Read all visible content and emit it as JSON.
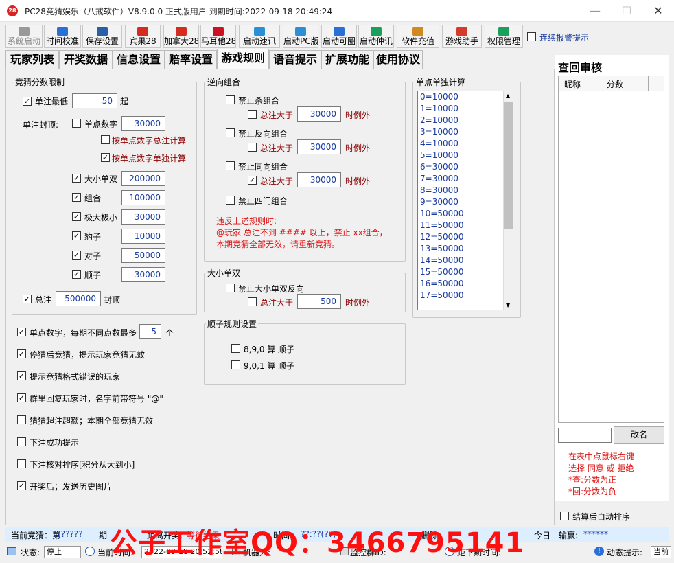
{
  "window": {
    "title": "PC28竞猜娱乐（八戒软件）V8.9.0.0  正式版用户  到期时间:2022-09-18 20:49:24",
    "icon_text": "28"
  },
  "toolbar": {
    "items": [
      {
        "label": "系统启动",
        "icon": "system-start-icon",
        "color": "#999999"
      },
      {
        "label": "时间校准",
        "icon": "clock-icon",
        "color": "#2a6fd6"
      },
      {
        "label": "保存设置",
        "icon": "save-icon",
        "color": "#2a5fa8"
      },
      {
        "label": "宾果28",
        "icon": "china-flag-icon",
        "color": "#d62b1f"
      },
      {
        "label": "加拿大28",
        "icon": "canada-flag-icon",
        "color": "#d62b1f"
      },
      {
        "label": "马耳他28",
        "icon": "malta-flag-icon",
        "color": "#cc1122"
      },
      {
        "label": "启动速讯",
        "icon": "chat-icon",
        "color": "#2a8fd6"
      },
      {
        "label": "启动PC版",
        "icon": "chat-icon",
        "color": "#2a8fd6"
      },
      {
        "label": "启动可圈",
        "icon": "circle-icon",
        "color": "#2a6fd6"
      },
      {
        "label": "启动仲讯",
        "icon": "chat-green-icon",
        "color": "#1aa05a"
      },
      {
        "label": "软件充值",
        "icon": "recharge-icon",
        "color": "#d08a20"
      },
      {
        "label": "游戏助手",
        "icon": "game-assistant-icon",
        "color": "#d63a2a"
      },
      {
        "label": "权限管理",
        "icon": "shield-icon",
        "color": "#1aa05a"
      }
    ],
    "alarm_label": "连续报警提示"
  },
  "tabs": [
    "玩家列表",
    "开奖数据",
    "信息设置",
    "赔率设置",
    "游戏规则",
    "语音提示",
    "扩展功能",
    "使用协议"
  ],
  "active_tab": "游戏规则",
  "bet_limit": {
    "legend": "竞猜分数限制",
    "min_label": "单注最低",
    "min_value": "50",
    "min_suffix": "起",
    "cap_label": "单注封顶:",
    "single_digit_label": "单点数字",
    "single_digit_value": "30000",
    "by_total_label": "按单点数字总注计算",
    "by_single_label": "按单点数字单独计算",
    "rows": [
      {
        "label": "大小单双",
        "value": "200000"
      },
      {
        "label": "组合",
        "value": "100000"
      },
      {
        "label": "极大极小",
        "value": "30000"
      },
      {
        "label": "豹子",
        "value": "10000"
      },
      {
        "label": "对子",
        "value": "50000"
      },
      {
        "label": "顺子",
        "value": "30000"
      }
    ],
    "total_label": "总注",
    "total_value": "500000",
    "total_suffix": "封顶"
  },
  "reverse_combo": {
    "legend": "逆向组合",
    "items": [
      {
        "label": "禁止杀组合",
        "sub_label": "总注大于",
        "value": "30000",
        "suffix": "时例外"
      },
      {
        "label": "禁止反向组合",
        "sub_label": "总注大于",
        "value": "30000",
        "suffix": "时例外"
      },
      {
        "label": "禁止同向组合",
        "sub_label": "总注大于",
        "value": "30000",
        "suffix": "时例外"
      }
    ],
    "four_label": "禁止四门组合",
    "warn_title": "违反上述规则时:",
    "warn_line1": "@玩家 总注不到 #### 以上，禁止 xx组合，",
    "warn_line2": "本期竞猜全部无效，请重新竞猜。"
  },
  "big_small": {
    "legend": "大小单双",
    "label": "禁止大小单双反向",
    "sub_label": "总注大于",
    "value": "500",
    "suffix": "时例外"
  },
  "straight": {
    "legend": "顺子规则设置",
    "opt1": "8,9,0 算 顺子",
    "opt2": "9,0,1 算 顺子"
  },
  "single_point": {
    "legend": "单点单独计算",
    "items": [
      "0=10000",
      "1=10000",
      "2=10000",
      "3=10000",
      "4=10000",
      "5=10000",
      "6=30000",
      "7=30000",
      "8=30000",
      "9=30000",
      "10=50000",
      "11=50000",
      "12=50000",
      "13=50000",
      "14=50000",
      "15=50000",
      "16=50000",
      "17=50000"
    ]
  },
  "options": {
    "opt1_prefix": "单点数字，每期不同点数最多",
    "opt1_value": "5",
    "opt1_suffix": "个",
    "opt2": "停猜后竞猜，提示玩家竞猜无效",
    "opt3": "提示竞猜格式错误的玩家",
    "opt4": "群里回复玩家时，名字前带符号 \"@\"",
    "opt5": "猜猜超注超额；本期全部竞猜无效",
    "opt6": "下注成功提示",
    "opt7": "下注核对排序[积分从大到小]",
    "opt8": "开奖后；发送历史图片"
  },
  "review": {
    "title": "查回审核",
    "col_nick": "昵称",
    "col_score": "分数",
    "rename_btn": "改名",
    "help1": "在表中点鼠标右键",
    "help2": "选择 同意 或 拒绝",
    "help3": "*查:分数为正",
    "help4": "*回:分数为负",
    "auto_sort": "结算后自动排序"
  },
  "status1": {
    "current": "当前竞猜：第",
    "issue": "???????",
    "period": "期",
    "distance": "距离开奖:",
    "waiting": "等待结果",
    "mid": "时间:",
    "mid_val": "??:??(??)",
    "mid2": "删除:",
    "today": "今日",
    "count_label": "输赢:",
    "count_val": "******"
  },
  "status2": {
    "state_label": "状态:",
    "state_val": "停止",
    "time_label": "当前时间:",
    "time_val": "2022-09-18 20:52:58",
    "bot_label": "机器人:",
    "monitor": "监控群ID:",
    "next": "距下期时间:",
    "dynamic": "动态提示:",
    "tail": "当前"
  },
  "watermark": "公子工作室QQ：3466795141",
  "colors": {
    "accent_blue": "#1a3ca0",
    "warn_red": "#dd1111",
    "watermark": "#ff1010"
  }
}
